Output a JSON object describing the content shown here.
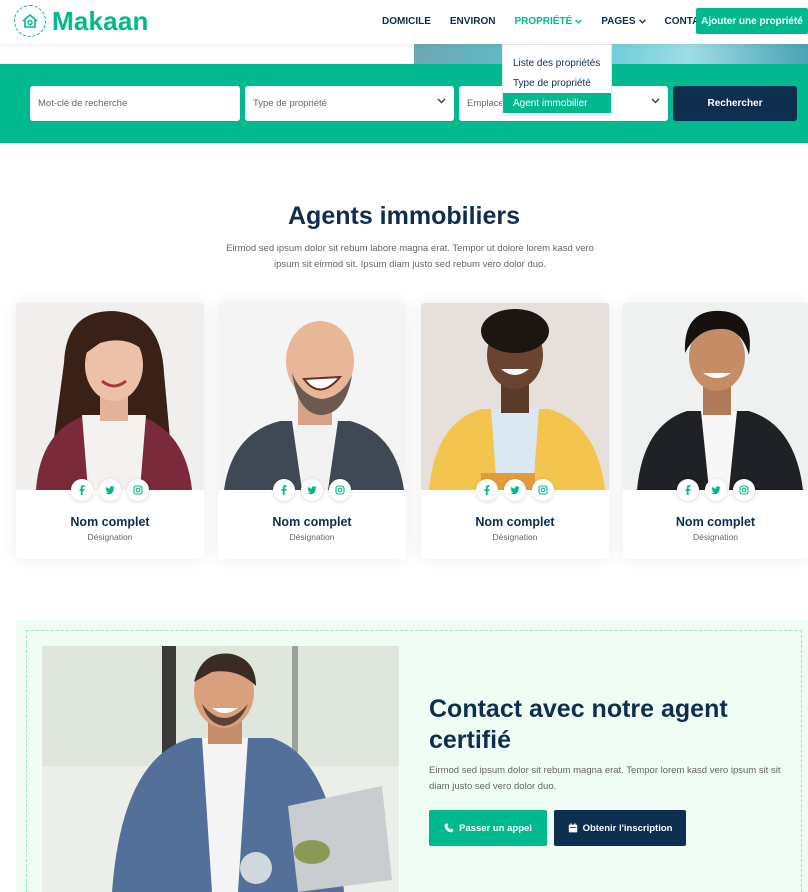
{
  "colors": {
    "primary": "#00B98E",
    "dark": "#0E2E50",
    "light_bg": "#EFFDF5",
    "text": "#666565"
  },
  "brand": {
    "name": "Makaan",
    "icon": "house-icon"
  },
  "nav": {
    "items": [
      {
        "label": "DOMICILE"
      },
      {
        "label": "ENVIRON"
      },
      {
        "label": "PROPRIÉTÉ",
        "active": true
      },
      {
        "label": "PAGES"
      },
      {
        "label": "CONTACT"
      }
    ],
    "cta": "Ajouter une propriété"
  },
  "dropdown": {
    "items": [
      {
        "label": "Liste des propriétés"
      },
      {
        "label": "Type de propriété"
      },
      {
        "label": "Agent immobilier",
        "active": true
      }
    ]
  },
  "search": {
    "keyword_placeholder": "Mot-clé de recherche",
    "type_placeholder": "Type de propriété",
    "location_placeholder": "Emplacement",
    "button": "Rechercher"
  },
  "agents_section": {
    "title": "Agents immobiliers",
    "subtitle": "Eirmod sed ipsum dolor sit rebum labore magna erat. Tempor ut dolore lorem kasd vero ipsum sit eirmod sit. Ipsum diam justo sed rebum vero dolor duo.",
    "agents": [
      {
        "name": "Nom complet",
        "role": "Désignation"
      },
      {
        "name": "Nom complet",
        "role": "Désignation"
      },
      {
        "name": "Nom complet",
        "role": "Désignation"
      },
      {
        "name": "Nom complet",
        "role": "Désignation"
      }
    ],
    "socials": [
      "facebook-icon",
      "twitter-icon",
      "instagram-icon"
    ]
  },
  "contact": {
    "title": "Contact avec notre agent certifié",
    "text": "Eirmod sed ipsum dolor sit rebum magna erat. Tempor lorem kasd vero ipsum sit sit diam justo sed vero dolor duo.",
    "call_button": "Passer un appel",
    "signup_button": "Obtenir l'inscription"
  }
}
